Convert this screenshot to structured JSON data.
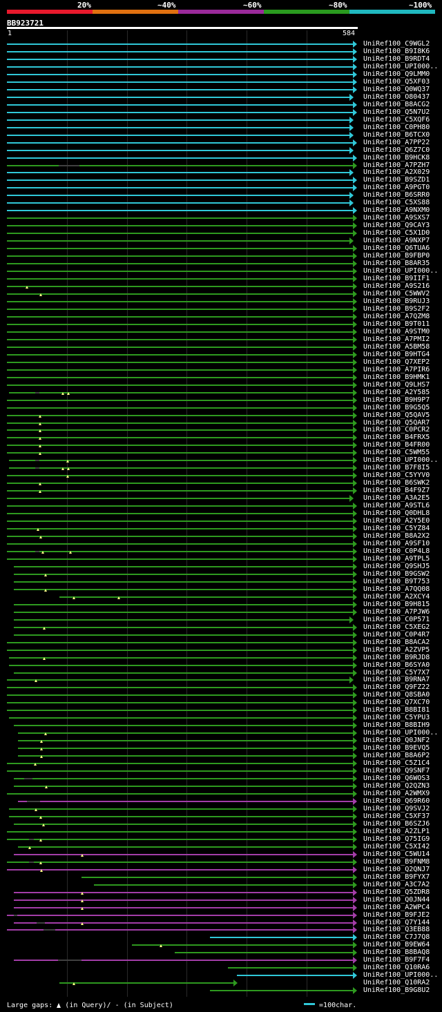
{
  "colors": {
    "cyan": "#30c8d8",
    "green": "#2e9a1f",
    "purple": "#a33da8",
    "red": "#e8192c",
    "orange": "#e07010",
    "violet": "#9a2a9a",
    "darkgreen": "#2a9a1f",
    "teal": "#20b8c0"
  },
  "scale": {
    "labels": [
      "20%",
      "~40%",
      "~60%",
      "~80%",
      "~100%"
    ],
    "segment_colors": [
      "red",
      "orange",
      "violet",
      "darkgreen",
      "teal"
    ]
  },
  "query": {
    "name": "BB923721",
    "start": "1",
    "end": "584",
    "length": 584
  },
  "rows": [
    {
      "label": "UniRef100_C9WGL2",
      "color": "cyan",
      "s": 1,
      "e": 584,
      "arrow": true
    },
    {
      "label": "UniRef100_B9I8K6",
      "color": "cyan",
      "s": 1,
      "e": 584,
      "arrow": true
    },
    {
      "label": "UniRef100_B9RDT4",
      "color": "cyan",
      "s": 1,
      "e": 584,
      "arrow": true
    },
    {
      "label": "UniRef100_UPI000..",
      "color": "cyan",
      "s": 1,
      "e": 584,
      "arrow": true
    },
    {
      "label": "UniRef100_Q9LMM0",
      "color": "cyan",
      "s": 1,
      "e": 584,
      "arrow": true
    },
    {
      "label": "UniRef100_Q5XF03",
      "color": "cyan",
      "s": 1,
      "e": 584,
      "arrow": true
    },
    {
      "label": "UniRef100_Q0WQ37",
      "color": "cyan",
      "s": 1,
      "e": 584,
      "arrow": true
    },
    {
      "label": "UniRef100_O80437",
      "color": "cyan",
      "s": 1,
      "e": 578,
      "arrow": true
    },
    {
      "label": "UniRef100_B8ACG2",
      "color": "cyan",
      "s": 1,
      "e": 584,
      "arrow": true
    },
    {
      "label": "UniRef100_Q5N7U2",
      "color": "cyan",
      "s": 1,
      "e": 584,
      "arrow": true
    },
    {
      "label": "UniRef100_C5XQF6",
      "color": "cyan",
      "s": 1,
      "e": 578,
      "arrow": true
    },
    {
      "label": "UniRef100_C0PH80",
      "color": "cyan",
      "s": 1,
      "e": 578,
      "arrow": true
    },
    {
      "label": "UniRef100_B6TCX0",
      "color": "cyan",
      "s": 1,
      "e": 578,
      "arrow": true
    },
    {
      "label": "UniRef100_A7PP22",
      "color": "cyan",
      "s": 1,
      "e": 584,
      "arrow": true
    },
    {
      "label": "UniRef100_Q6Z7C0",
      "color": "cyan",
      "s": 1,
      "e": 578,
      "arrow": true
    },
    {
      "label": "UniRef100_B9HCK8",
      "color": "cyan",
      "s": 1,
      "e": 584,
      "arrow": true
    },
    {
      "label": "UniRef100_A7PZH7",
      "color": "green",
      "s": 1,
      "e": 584,
      "arrow": true,
      "gap": [
        87,
        122
      ]
    },
    {
      "label": "UniRef100_A2X029",
      "color": "cyan",
      "s": 1,
      "e": 578,
      "arrow": true
    },
    {
      "label": "UniRef100_B9SZD1",
      "color": "cyan",
      "s": 1,
      "e": 584,
      "arrow": true
    },
    {
      "label": "UniRef100_A9PGT0",
      "color": "cyan",
      "s": 1,
      "e": 584,
      "arrow": true
    },
    {
      "label": "UniRef100_B6SRR0",
      "color": "cyan",
      "s": 1,
      "e": 578,
      "arrow": true
    },
    {
      "label": "UniRef100_C5XS88",
      "color": "cyan",
      "s": 1,
      "e": 578,
      "arrow": true
    },
    {
      "label": "UniRef100_A9NXM0",
      "color": "cyan",
      "s": 1,
      "e": 584,
      "arrow": true
    },
    {
      "label": "UniRef100_A9SXS7",
      "color": "green",
      "s": 1,
      "e": 584,
      "arrow": true
    },
    {
      "label": "UniRef100_Q9CAY3",
      "color": "green",
      "s": 1,
      "e": 584,
      "arrow": true
    },
    {
      "label": "UniRef100_C5X1D0",
      "color": "green",
      "s": 1,
      "e": 584,
      "arrow": true
    },
    {
      "label": "UniRef100_A9NXP7",
      "color": "green",
      "s": 1,
      "e": 578,
      "arrow": true
    },
    {
      "label": "UniRef100_Q6TUA6",
      "color": "green",
      "s": 1,
      "e": 584,
      "arrow": true
    },
    {
      "label": "UniRef100_B9FBP0",
      "color": "green",
      "s": 1,
      "e": 584,
      "arrow": true
    },
    {
      "label": "UniRef100_B8AR35",
      "color": "green",
      "s": 1,
      "e": 584,
      "arrow": true
    },
    {
      "label": "UniRef100_UPI000..",
      "color": "green",
      "s": 1,
      "e": 584,
      "arrow": true
    },
    {
      "label": "UniRef100_B9IIF1",
      "color": "green",
      "s": 1,
      "e": 584,
      "arrow": true
    },
    {
      "label": "UniRef100_A9S216",
      "color": "green",
      "s": 1,
      "e": 584,
      "arrow": true,
      "marks": [
        34
      ]
    },
    {
      "label": "UniRef100_C5WWV2",
      "color": "green",
      "s": 1,
      "e": 584,
      "arrow": true,
      "marks": [
        57
      ]
    },
    {
      "label": "UniRef100_B9RUJ3",
      "color": "green",
      "s": 1,
      "e": 584,
      "arrow": true
    },
    {
      "label": "UniRef100_B9S2F2",
      "color": "green",
      "s": 1,
      "e": 584,
      "arrow": true
    },
    {
      "label": "UniRef100_A7QZM8",
      "color": "green",
      "s": 1,
      "e": 584,
      "arrow": true
    },
    {
      "label": "UniRef100_B9T011",
      "color": "green",
      "s": 1,
      "e": 584,
      "arrow": true
    },
    {
      "label": "UniRef100_A9STM0",
      "color": "green",
      "s": 1,
      "e": 584,
      "arrow": true
    },
    {
      "label": "UniRef100_A7PMI2",
      "color": "green",
      "s": 1,
      "e": 584,
      "arrow": true
    },
    {
      "label": "UniRef100_A5BM58",
      "color": "green",
      "s": 1,
      "e": 584,
      "arrow": true
    },
    {
      "label": "UniRef100_B9HTG4",
      "color": "green",
      "s": 1,
      "e": 584,
      "arrow": true
    },
    {
      "label": "UniRef100_Q7XEP2",
      "color": "green",
      "s": 1,
      "e": 584,
      "arrow": true
    },
    {
      "label": "UniRef100_A7PIR6",
      "color": "green",
      "s": 1,
      "e": 584,
      "arrow": true
    },
    {
      "label": "UniRef100_B9HMK1",
      "color": "green",
      "s": 1,
      "e": 584,
      "arrow": true
    },
    {
      "label": "UniRef100_Q9LHS7",
      "color": "green",
      "s": 1,
      "e": 584,
      "arrow": true
    },
    {
      "label": "UniRef100_A2Y585",
      "color": "green",
      "s": 4,
      "e": 584,
      "arrow": true,
      "marks": [
        94,
        104
      ],
      "gap": [
        48,
        55
      ]
    },
    {
      "label": "UniRef100_B9H9P7",
      "color": "green",
      "s": 1,
      "e": 584,
      "arrow": true
    },
    {
      "label": "UniRef100_B9G5Q5",
      "color": "green",
      "s": 1,
      "e": 584,
      "arrow": true
    },
    {
      "label": "UniRef100_Q5QAV5",
      "color": "green",
      "s": 1,
      "e": 584,
      "arrow": true,
      "marks": [
        56
      ]
    },
    {
      "label": "UniRef100_Q5QAR7",
      "color": "green",
      "s": 1,
      "e": 584,
      "arrow": true,
      "marks": [
        56
      ]
    },
    {
      "label": "UniRef100_C0PCR2",
      "color": "green",
      "s": 1,
      "e": 584,
      "arrow": true,
      "marks": [
        56
      ]
    },
    {
      "label": "UniRef100_B4FRX5",
      "color": "green",
      "s": 1,
      "e": 584,
      "arrow": true,
      "marks": [
        56
      ]
    },
    {
      "label": "UniRef100_B4FR00",
      "color": "green",
      "s": 1,
      "e": 584,
      "arrow": true,
      "marks": [
        56
      ]
    },
    {
      "label": "UniRef100_C5WM55",
      "color": "green",
      "s": 1,
      "e": 584,
      "arrow": true,
      "marks": [
        56
      ]
    },
    {
      "label": "UniRef100_UPI000..",
      "color": "green",
      "s": 4,
      "e": 584,
      "arrow": true,
      "marks": [
        102
      ],
      "gap": [
        48,
        55
      ]
    },
    {
      "label": "UniRef100_B7F8I5",
      "color": "green",
      "s": 4,
      "e": 584,
      "arrow": true,
      "marks": [
        94,
        104
      ],
      "gap": [
        48,
        55
      ]
    },
    {
      "label": "UniRef100_C5YYV0",
      "color": "green",
      "s": 1,
      "e": 584,
      "arrow": true,
      "marks": [
        102
      ]
    },
    {
      "label": "UniRef100_B6SWK2",
      "color": "green",
      "s": 1,
      "e": 584,
      "arrow": true,
      "marks": [
        56
      ]
    },
    {
      "label": "UniRef100_B4F9Z7",
      "color": "green",
      "s": 1,
      "e": 584,
      "arrow": true,
      "marks": [
        56
      ]
    },
    {
      "label": "UniRef100_A3A2E5",
      "color": "green",
      "s": 1,
      "e": 578,
      "arrow": true
    },
    {
      "label": "UniRef100_A9STL6",
      "color": "green",
      "s": 1,
      "e": 584,
      "arrow": true
    },
    {
      "label": "UniRef100_Q0DHL8",
      "color": "green",
      "s": 1,
      "e": 584,
      "arrow": true
    },
    {
      "label": "UniRef100_A2Y5E0",
      "color": "green",
      "s": 1,
      "e": 584,
      "arrow": true
    },
    {
      "label": "UniRef100_C5YZ84",
      "color": "green",
      "s": 1,
      "e": 584,
      "arrow": true,
      "marks": [
        53
      ]
    },
    {
      "label": "UniRef100_B8A2X2",
      "color": "green",
      "s": 1,
      "e": 584,
      "arrow": true,
      "marks": [
        57
      ]
    },
    {
      "label": "UniRef100_A9SF10",
      "color": "green",
      "s": 1,
      "e": 584,
      "arrow": true
    },
    {
      "label": "UniRef100_C0P4L8",
      "color": "green",
      "s": 1,
      "e": 584,
      "arrow": true,
      "marks": [
        61,
        107
      ],
      "gap": [
        48,
        55
      ]
    },
    {
      "label": "UniRef100_A9TPL5",
      "color": "green",
      "s": 1,
      "e": 584,
      "arrow": true
    },
    {
      "label": "UniRef100_Q9SHJ5",
      "color": "green",
      "s": 13,
      "e": 584,
      "arrow": true
    },
    {
      "label": "UniRef100_B9GSW2",
      "color": "green",
      "s": 13,
      "e": 584,
      "arrow": true,
      "marks": [
        66
      ]
    },
    {
      "label": "UniRef100_B9T753",
      "color": "green",
      "s": 13,
      "e": 584,
      "arrow": true
    },
    {
      "label": "UniRef100_A7QQ08",
      "color": "green",
      "s": 13,
      "e": 584,
      "arrow": true,
      "marks": [
        66
      ]
    },
    {
      "label": "UniRef100_A2XCY4",
      "color": "green",
      "s": 89,
      "e": 584,
      "arrow": true,
      "marks": [
        113,
        188
      ]
    },
    {
      "label": "UniRef100_B9H815",
      "color": "green",
      "s": 13,
      "e": 584,
      "arrow": true
    },
    {
      "label": "UniRef100_A7PJW6",
      "color": "green",
      "s": 13,
      "e": 584,
      "arrow": true
    },
    {
      "label": "UniRef100_C0P571",
      "color": "green",
      "s": 13,
      "e": 578,
      "arrow": true
    },
    {
      "label": "UniRef100_C5XEG2",
      "color": "green",
      "s": 13,
      "e": 584,
      "arrow": true,
      "marks": [
        63
      ]
    },
    {
      "label": "UniRef100_C0P4R7",
      "color": "green",
      "s": 13,
      "e": 584,
      "arrow": true
    },
    {
      "label": "UniRef100_B8ACA2",
      "color": "green",
      "s": 1,
      "e": 584,
      "arrow": true
    },
    {
      "label": "UniRef100_A2ZVP5",
      "color": "green",
      "s": 1,
      "e": 584,
      "arrow": true
    },
    {
      "label": "UniRef100_B9RJD8",
      "color": "green",
      "s": 4,
      "e": 584,
      "arrow": true,
      "marks": [
        63
      ]
    },
    {
      "label": "UniRef100_B6SYA0",
      "color": "green",
      "s": 4,
      "e": 584,
      "arrow": true
    },
    {
      "label": "UniRef100_C5Y7X7",
      "color": "green",
      "s": 13,
      "e": 584,
      "arrow": true
    },
    {
      "label": "UniRef100_B9RNA7",
      "color": "green",
      "s": 1,
      "e": 578,
      "arrow": true,
      "marks": [
        49
      ]
    },
    {
      "label": "UniRef100_Q9FZ22",
      "color": "green",
      "s": 1,
      "e": 584,
      "arrow": true
    },
    {
      "label": "UniRef100_Q8SBA0",
      "color": "green",
      "s": 1,
      "e": 584,
      "arrow": true
    },
    {
      "label": "UniRef100_Q7XC70",
      "color": "green",
      "s": 1,
      "e": 584,
      "arrow": true
    },
    {
      "label": "UniRef100_B8BI81",
      "color": "green",
      "s": 1,
      "e": 584,
      "arrow": true
    },
    {
      "label": "UniRef100_C5YPU3",
      "color": "green",
      "s": 4,
      "e": 584,
      "arrow": true
    },
    {
      "label": "UniRef100_B8BIH9",
      "color": "green",
      "s": 13,
      "e": 584,
      "arrow": true
    },
    {
      "label": "UniRef100_UPI000..",
      "color": "green",
      "s": 19,
      "e": 584,
      "arrow": true,
      "marks": [
        66
      ]
    },
    {
      "label": "UniRef100_Q0JNF2",
      "color": "green",
      "s": 19,
      "e": 584,
      "arrow": true,
      "marks": [
        59
      ]
    },
    {
      "label": "UniRef100_B9EVQ5",
      "color": "green",
      "s": 19,
      "e": 584,
      "arrow": true,
      "marks": [
        59
      ]
    },
    {
      "label": "UniRef100_B8A6P2",
      "color": "green",
      "s": 19,
      "e": 584,
      "arrow": true,
      "marks": [
        59
      ]
    },
    {
      "label": "UniRef100_C5Z1C4",
      "color": "green",
      "s": 1,
      "e": 584,
      "arrow": true,
      "marks": [
        48
      ]
    },
    {
      "label": "UniRef100_Q9SNF7",
      "color": "green",
      "s": 1,
      "e": 584,
      "arrow": true
    },
    {
      "label": "UniRef100_Q6WOS3",
      "color": "green",
      "s": 13,
      "e": 584,
      "arrow": true,
      "gap": [
        30,
        44
      ]
    },
    {
      "label": "UniRef100_Q2QZN3",
      "color": "green",
      "s": 13,
      "e": 584,
      "arrow": true,
      "marks": [
        67
      ]
    },
    {
      "label": "UniRef100_A2WMX9",
      "color": "green",
      "s": 1,
      "e": 584,
      "arrow": true
    },
    {
      "label": "UniRef100_Q69R60",
      "color": "purple",
      "s": 19,
      "e": 584,
      "arrow": true,
      "gap": [
        34,
        56
      ]
    },
    {
      "label": "UniRef100_Q9SVJ2",
      "color": "green",
      "s": 4,
      "e": 584,
      "arrow": true,
      "marks": [
        49
      ]
    },
    {
      "label": "UniRef100_C5XF37",
      "color": "green",
      "s": 4,
      "e": 584,
      "arrow": true,
      "marks": [
        58
      ]
    },
    {
      "label": "UniRef100_B6SZJ6",
      "color": "green",
      "s": 13,
      "e": 584,
      "arrow": true,
      "marks": [
        62
      ]
    },
    {
      "label": "UniRef100_A2ZLP1",
      "color": "green",
      "s": 1,
      "e": 584,
      "arrow": true
    },
    {
      "label": "UniRef100_Q75IG9",
      "color": "green",
      "s": 1,
      "e": 584,
      "arrow": true,
      "marks": [
        58
      ],
      "gap": [
        38,
        46
      ]
    },
    {
      "label": "UniRef100_C5XI42",
      "color": "green",
      "s": 19,
      "e": 584,
      "arrow": true,
      "marks": [
        39
      ]
    },
    {
      "label": "UniRef100_C5WU14",
      "color": "purple",
      "s": 13,
      "e": 584,
      "arrow": true,
      "marks": [
        127
      ]
    },
    {
      "label": "UniRef100_B9FNM8",
      "color": "green",
      "s": 1,
      "e": 584,
      "arrow": true,
      "marks": [
        58
      ],
      "gap": [
        38,
        46
      ]
    },
    {
      "label": "UniRef100_Q2QNJ7",
      "color": "purple",
      "s": 1,
      "e": 584,
      "arrow": true,
      "marks": [
        59
      ]
    },
    {
      "label": "UniRef100_B9FYX7",
      "color": "green",
      "s": 126,
      "e": 584,
      "arrow": true
    },
    {
      "label": "UniRef100_A3C7A2",
      "color": "green",
      "s": 146,
      "e": 584,
      "arrow": true
    },
    {
      "label": "UniRef100_Q5ZDR8",
      "color": "purple",
      "s": 13,
      "e": 584,
      "arrow": true,
      "marks": [
        127
      ]
    },
    {
      "label": "UniRef100_Q0JN44",
      "color": "purple",
      "s": 13,
      "e": 584,
      "arrow": true,
      "marks": [
        127
      ]
    },
    {
      "label": "UniRef100_A2WPC4",
      "color": "purple",
      "s": 13,
      "e": 584,
      "arrow": true,
      "marks": [
        127
      ]
    },
    {
      "label": "UniRef100_B9FJE2",
      "color": "purple",
      "s": 1,
      "e": 584,
      "arrow": true,
      "gap": [
        12,
        18
      ]
    },
    {
      "label": "UniRef100_Q7Y144",
      "color": "purple",
      "s": 13,
      "e": 584,
      "arrow": true,
      "marks": [
        127
      ],
      "gap": [
        50,
        64
      ]
    },
    {
      "label": "UniRef100_Q3EB88",
      "color": "purple",
      "s": 1,
      "e": 584,
      "arrow": true,
      "gap": [
        62,
        82
      ]
    },
    {
      "label": "UniRef100_C7J7Q8",
      "color": "cyan",
      "s": 340,
      "e": 584,
      "arrow": true
    },
    {
      "label": "UniRef100_B9EW64",
      "color": "green",
      "s": 210,
      "e": 584,
      "arrow": true,
      "marks": [
        258
      ]
    },
    {
      "label": "UniRef100_B8BAQ8",
      "color": "green",
      "s": 281,
      "e": 584,
      "arrow": true
    },
    {
      "label": "UniRef100_B9F7F4",
      "color": "purple",
      "s": 13,
      "e": 584,
      "arrow": true,
      "gap": [
        86,
        126
      ]
    },
    {
      "label": "UniRef100_Q10RA6",
      "color": "green",
      "s": 370,
      "e": 584,
      "arrow": true
    },
    {
      "label": "UniRef100_UPI000..",
      "color": "cyan",
      "s": 385,
      "e": 584,
      "arrow": true
    },
    {
      "label": "UniRef100_Q10RA2",
      "color": "green",
      "s": 89,
      "e": 385,
      "arrow": true,
      "marks": [
        113
      ]
    },
    {
      "label": "UniRef100_B9G8U2",
      "color": "green",
      "s": 340,
      "e": 584,
      "arrow": true
    }
  ],
  "footer": {
    "text_a": "Large gaps:",
    "text_b": "(in Query)/",
    "text_c": "- (in Subject)",
    "legend": "=100char."
  }
}
